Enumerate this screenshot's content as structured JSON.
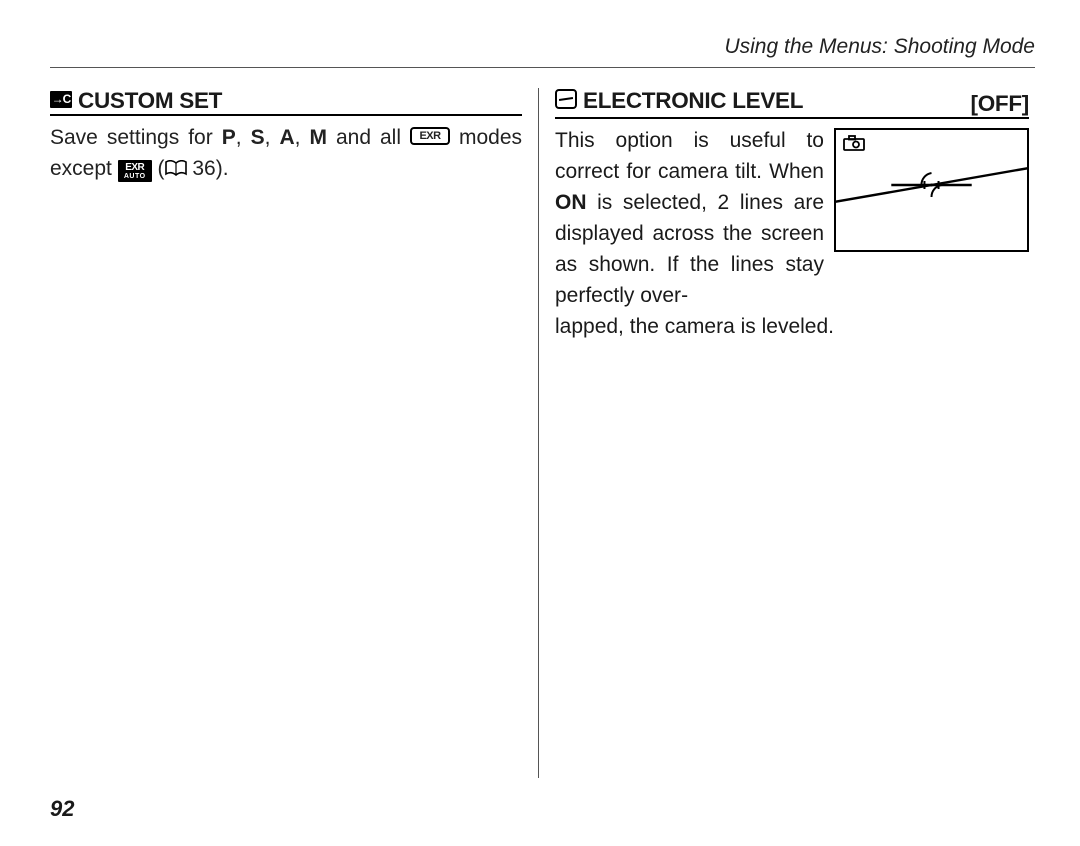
{
  "header": "Using the Menus: Shooting Mode",
  "pageNumber": "92",
  "left": {
    "title": "CUSTOM SET",
    "t1": "Save settings for ",
    "P": "P",
    "S": "S",
    "A": "A",
    "M": "M",
    "comma": ", ",
    "t2": " and all ",
    "t3": " modes except ",
    "t4": " (",
    "page": " 36",
    "t5": ")."
  },
  "right": {
    "title": "ELECTRONIC LEVEL",
    "status": "[OFF]",
    "t1": "This option is useful to correct for camera tilt.  When ",
    "ON": "ON",
    "t2": " is selected, 2 lines are displayed across the screen as shown.  If the lines stay perfectly over",
    "t3": "lapped, the camera is leveled."
  }
}
